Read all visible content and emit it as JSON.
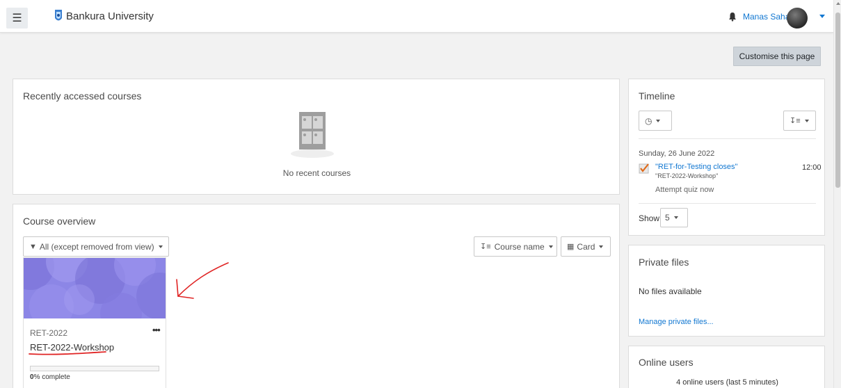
{
  "navbar": {
    "menu_icon": "hamburger-icon",
    "site_name": "Bankura University",
    "notification_icon": "bell-icon",
    "user_name": "Manas Saha"
  },
  "page": {
    "customise_label": "Customise this page"
  },
  "recent_courses": {
    "title": "Recently accessed courses",
    "empty_text": "No recent courses"
  },
  "course_overview": {
    "title": "Course overview",
    "filter_label": "All (except removed from view)",
    "sort_label": "Course name",
    "view_label": "Card",
    "courses": [
      {
        "category": "RET-2022",
        "name": "RET-2022-Workshop",
        "progress_percent": 0,
        "progress_value": "0",
        "progress_suffix": "% complete",
        "menu_icon": "ellipsis-icon"
      }
    ]
  },
  "timeline": {
    "title": "Timeline",
    "date_heading": "Sunday, 26 June 2022",
    "event_title": "\"RET-for-Testing closes\"",
    "event_course": "\"RET-2022-Workshop\"",
    "event_time": "12:00",
    "event_action": "Attempt quiz now",
    "show_label": "Show",
    "show_value": "5"
  },
  "private_files": {
    "title": "Private files",
    "empty_text": "No files available",
    "manage_link": "Manage private files..."
  },
  "online_users": {
    "title": "Online users",
    "summary": "4 online users (last 5 minutes)"
  },
  "colors": {
    "link": "#1177d1",
    "course_image": "#8c86e6",
    "annotation": "#e02424"
  }
}
